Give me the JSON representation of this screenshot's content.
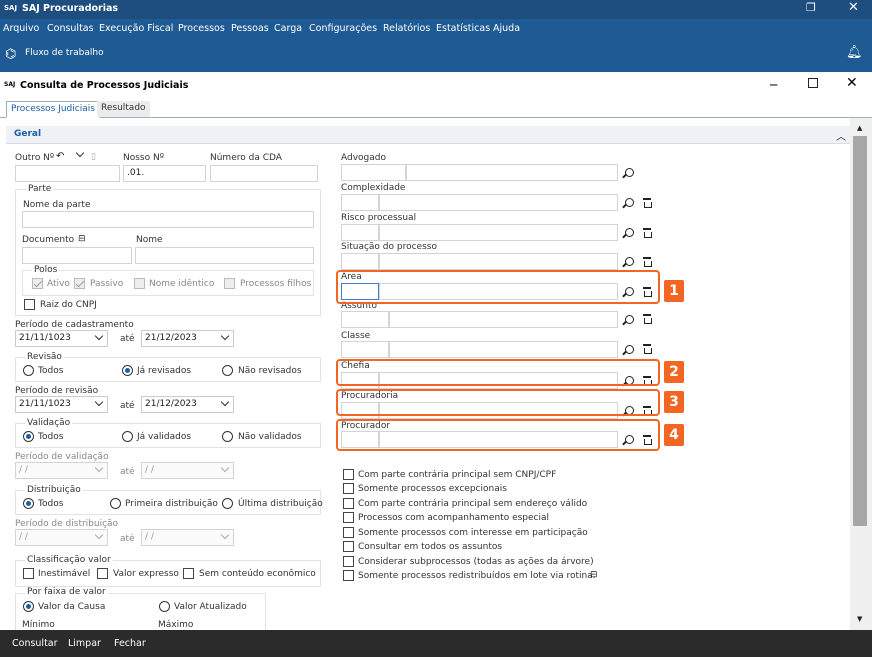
{
  "app": {
    "logo": "SAJ",
    "title": "SAJ Procuradorias"
  },
  "menu": [
    "Arquivo",
    "Consultas",
    "Execução Fiscal",
    "Processos",
    "Pessoas",
    "Carga",
    "Configurações",
    "Relatórios",
    "Estatísticas",
    "Ajuda"
  ],
  "toolbar": {
    "fluxo": "Fluxo de trabalho"
  },
  "window": {
    "logo": "SAJ",
    "title": "Consulta de Processos Judiciais"
  },
  "tabs": [
    "Processos Judiciais",
    "Resultado"
  ],
  "section": "Geral",
  "left": {
    "outro_label": "Outro Nº",
    "nosso_label": "Nosso Nº",
    "nosso_value": ".01.",
    "cda_label": "Número da CDA",
    "parte_title": "Parte",
    "nome_parte": "Nome da parte",
    "documento": "Documento",
    "nome": "Nome",
    "polos_title": "Polos",
    "ativo": "Ativo",
    "passivo": "Passivo",
    "nome_identico": "Nome idêntico",
    "processos_filhos": "Processos filhos",
    "raiz": "Raiz do CNPJ",
    "periodo_cad": "Período de cadastramento",
    "cad_de": "21/11/1023",
    "ate": "até",
    "cad_ate": "21/12/2023",
    "revisao_title": "Revisão",
    "todos": "Todos",
    "ja_revisados": "Já revisados",
    "nao_revisados": "Não revisados",
    "periodo_rev": "Período de revisão",
    "rev_de": "21/11/1023",
    "rev_ate": "21/12/2023",
    "validacao_title": "Validação",
    "ja_validados": "Já validados",
    "nao_validados": "Não validados",
    "periodo_val": "Período de validação",
    "empty_date": "/ /",
    "distribuicao_title": "Distribuição",
    "primeira": "Primeira distribuição",
    "ultima": "Última distribuição",
    "periodo_dist": "Período de distribuição",
    "class_title": "Classificação valor",
    "inestimavel": "Inestimável",
    "valor_expresso": "Valor expresso",
    "sem_conteudo": "Sem conteúdo econômico",
    "faixa_title": "Por faixa de valor",
    "valor_causa": "Valor da Causa",
    "valor_atualizado": "Valor Atualizado",
    "minimo": "Mínimo",
    "maximo": "Máximo"
  },
  "right": {
    "advogado": "Advogado",
    "complexidade": "Complexidade",
    "risco": "Risco processual",
    "situacao": "Situação do processo",
    "area": "Área",
    "assunto": "Assunto",
    "classe": "Classe",
    "chefia": "Chefia",
    "procuradoria": "Procuradoria",
    "procurador": "Procurador",
    "checks": [
      "Com parte contrária principal sem CNPJ/CPF",
      "Somente processos excepcionais",
      "Com parte contrária principal sem endereço válido",
      "Processos com acompanhamento especial",
      "Somente processos com interesse em participação",
      "Consultar em todos os assuntos",
      "Considerar subprocessos (todas as ações da árvore)",
      "Somente processos redistribuídos em lote via rotina."
    ]
  },
  "badges": [
    "1",
    "2",
    "3",
    "4"
  ],
  "bottom": [
    "Consultar",
    "Limpar",
    "Fechar"
  ],
  "colors": {
    "menubar": "#1e5a93",
    "highlight": "#f26522",
    "bottombar": "#2b2b2b"
  }
}
